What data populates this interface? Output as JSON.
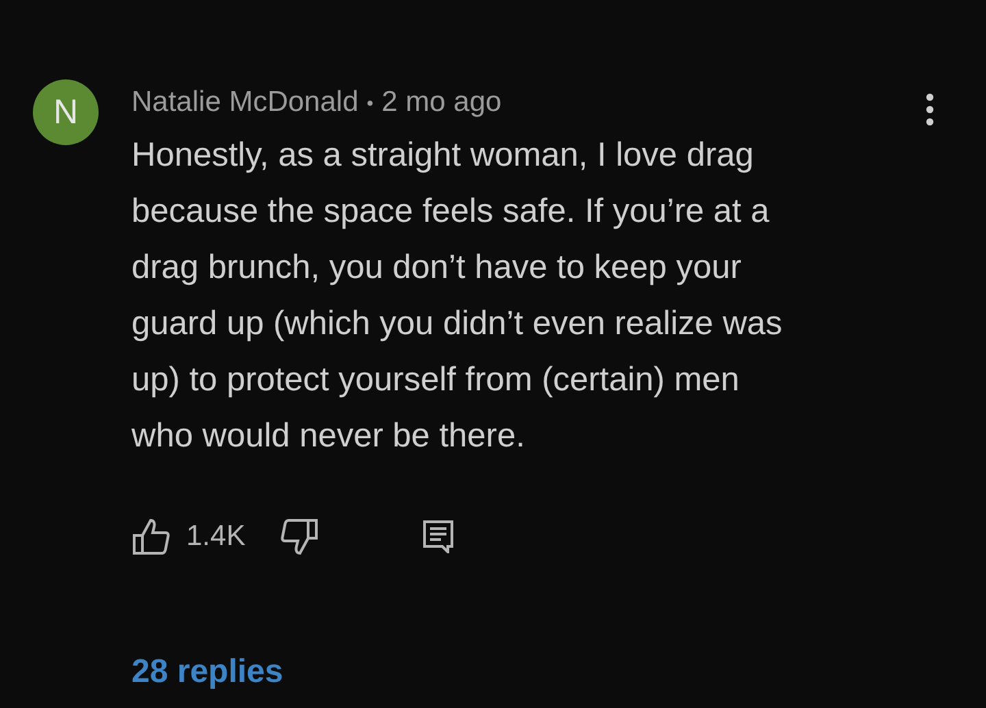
{
  "comment": {
    "avatar_letter": "N",
    "author": "Natalie McDonald",
    "separator": "•",
    "time": "2 mo ago",
    "text": "Honestly, as a straight woman, I love drag\nbecause the space feels safe. If you’re at a\ndrag brunch, you don’t have to keep your\nguard up (which you didn’t even realize was\nup) to protect yourself from (certain) men\nwho would never be there.",
    "likes": "1.4K",
    "replies": "28 replies"
  }
}
